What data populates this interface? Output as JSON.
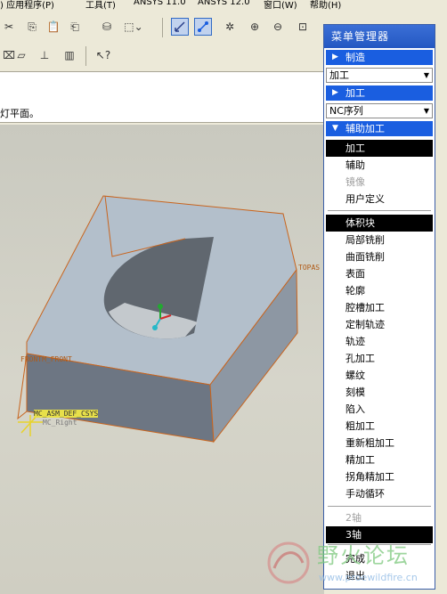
{
  "menubar": {
    "items": [
      "应用程序(P)",
      "工具(T)",
      "ANSYS 11.0",
      "ANSYS 12.0",
      "窗口(W)",
      "帮助(H)"
    ]
  },
  "toolbar": {
    "selected_tool": "view-orient-tool"
  },
  "message": {
    "text": "灯平面。"
  },
  "graphics": {
    "datum_top": "TOPAS",
    "datum_front": "FRONTM_FRONT",
    "csys": "MC_ASM_DEF_CSYS",
    "datum_right": "MC_Right"
  },
  "menu_manager": {
    "title": "菜单管理器",
    "headers": {
      "manufacture": "制造",
      "machining": "加工",
      "aux_machining": "辅助加工"
    },
    "combos": {
      "machining": "加工",
      "nc_sequence": "NC序列"
    },
    "group1": [
      {
        "label": "加工",
        "state": "selected"
      },
      {
        "label": "辅助",
        "state": "normal"
      },
      {
        "label": "镜像",
        "state": "disabled"
      },
      {
        "label": "用户定义",
        "state": "normal"
      }
    ],
    "group2": [
      {
        "label": "体积块",
        "state": "selected"
      },
      {
        "label": "局部铣削",
        "state": "normal"
      },
      {
        "label": "曲面铣削",
        "state": "normal"
      },
      {
        "label": "表面",
        "state": "normal"
      },
      {
        "label": "轮廓",
        "state": "normal"
      },
      {
        "label": "腔槽加工",
        "state": "normal"
      },
      {
        "label": "定制轨迹",
        "state": "normal"
      },
      {
        "label": "轨迹",
        "state": "normal"
      },
      {
        "label": "孔加工",
        "state": "normal"
      },
      {
        "label": "螺纹",
        "state": "normal"
      },
      {
        "label": "刻模",
        "state": "normal"
      },
      {
        "label": "陷入",
        "state": "normal"
      },
      {
        "label": "粗加工",
        "state": "normal"
      },
      {
        "label": "重新粗加工",
        "state": "normal"
      },
      {
        "label": "精加工",
        "state": "normal"
      },
      {
        "label": "拐角精加工",
        "state": "normal"
      },
      {
        "label": "手动循环",
        "state": "normal"
      }
    ],
    "group3": [
      {
        "label": "2轴",
        "state": "disabled"
      },
      {
        "label": "3轴",
        "state": "selected"
      }
    ],
    "group4": [
      {
        "label": "完成",
        "state": "normal"
      },
      {
        "label": "退出",
        "state": "normal"
      }
    ]
  },
  "watermark": {
    "text": "野火论坛",
    "url": "www.proewildfire.cn"
  },
  "colors": {
    "menu_header": "#1a5ee0",
    "menu_title": "#2f63cf",
    "part_face": "#b4bfca",
    "datum_edge": "#c8641e"
  }
}
